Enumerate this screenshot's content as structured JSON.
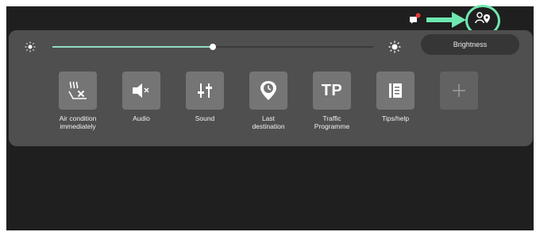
{
  "colors": {
    "screen_bg": "#1f1f1f",
    "panel_bg": "#4f4f4f",
    "tile_bg": "#757575",
    "slider_fill": "#8fdcc0",
    "highlight": "#6fe8b0",
    "notification_dot": "#e53935"
  },
  "status_bar": {
    "icons": [
      "message-notification-icon",
      "arrow-right-icon",
      "user-location-icon"
    ]
  },
  "brightness": {
    "level": 0.5,
    "button_label": "Brightness"
  },
  "tiles": [
    {
      "id": "air",
      "label": "Air condition\nimmediately",
      "icon": "air-condition-icon"
    },
    {
      "id": "audio",
      "label": "Audio",
      "icon": "speaker-mute-icon"
    },
    {
      "id": "sound",
      "label": "Sound",
      "icon": "equalizer-icon"
    },
    {
      "id": "last",
      "label": "Last\ndestination",
      "icon": "last-destination-icon"
    },
    {
      "id": "tp",
      "label": "Traffic\nProgramme",
      "icon_text": "TP"
    },
    {
      "id": "tips",
      "label": "Tips/help",
      "icon": "book-icon"
    },
    {
      "id": "add",
      "label": "",
      "icon": "plus-icon"
    }
  ]
}
